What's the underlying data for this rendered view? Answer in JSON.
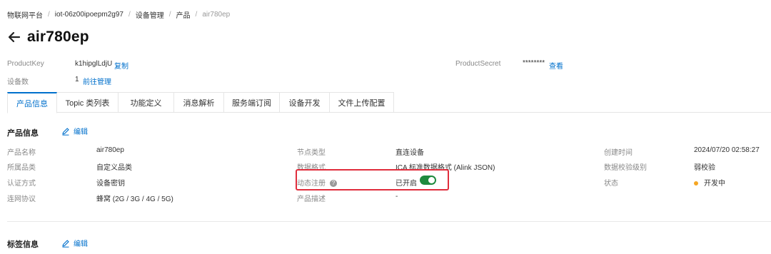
{
  "breadcrumb": [
    "物联网平台",
    "iot-06z00ipoepm2g97",
    "设备管理",
    "产品",
    "air780ep"
  ],
  "page_title": "air780ep",
  "header": {
    "product_key_label": "ProductKey",
    "product_key_value": "k1hipglLdjU",
    "copy_label": "复制",
    "device_count_label": "设备数",
    "device_count_value": "1",
    "manage_label": "前往管理",
    "product_secret_label": "ProductSecret",
    "product_secret_value": "********",
    "view_label": "查看"
  },
  "tabs": [
    {
      "label": "产品信息",
      "active": true
    },
    {
      "label": "Topic 类列表",
      "active": false
    },
    {
      "label": "功能定义",
      "active": false
    },
    {
      "label": "消息解析",
      "active": false
    },
    {
      "label": "服务端订阅",
      "active": false
    },
    {
      "label": "设备开发",
      "active": false
    },
    {
      "label": "文件上传配置",
      "active": false
    }
  ],
  "product_info": {
    "title": "产品信息",
    "edit_label": "编辑",
    "fields": {
      "name_label": "产品名称",
      "name_value": "air780ep",
      "category_label": "所属品类",
      "category_value": "自定义品类",
      "auth_label": "认证方式",
      "auth_value": "设备密钥",
      "network_label": "连网协议",
      "network_value": "蜂窝 (2G / 3G / 4G / 5G)",
      "node_label": "节点类型",
      "node_value": "直连设备",
      "format_label": "数据格式",
      "format_value": "ICA 标准数据格式 (Alink JSON)",
      "dynreg_label": "动态注册",
      "dynreg_value": "已开启",
      "desc_label": "产品描述",
      "desc_value": "-",
      "created_label": "创建时间",
      "created_value": "2024/07/20 02:58:27",
      "verify_label": "数据校验级别",
      "verify_value": "弱校验",
      "status_label": "状态",
      "status_value": "开发中"
    },
    "dynreg_enabled": true
  },
  "tag_info": {
    "title": "标签信息",
    "edit_label": "编辑"
  },
  "colors": {
    "accent": "#0070cc",
    "highlight": "#e02d3c",
    "toggle_on": "#1e8a3e",
    "status_dev": "#f5a623"
  }
}
